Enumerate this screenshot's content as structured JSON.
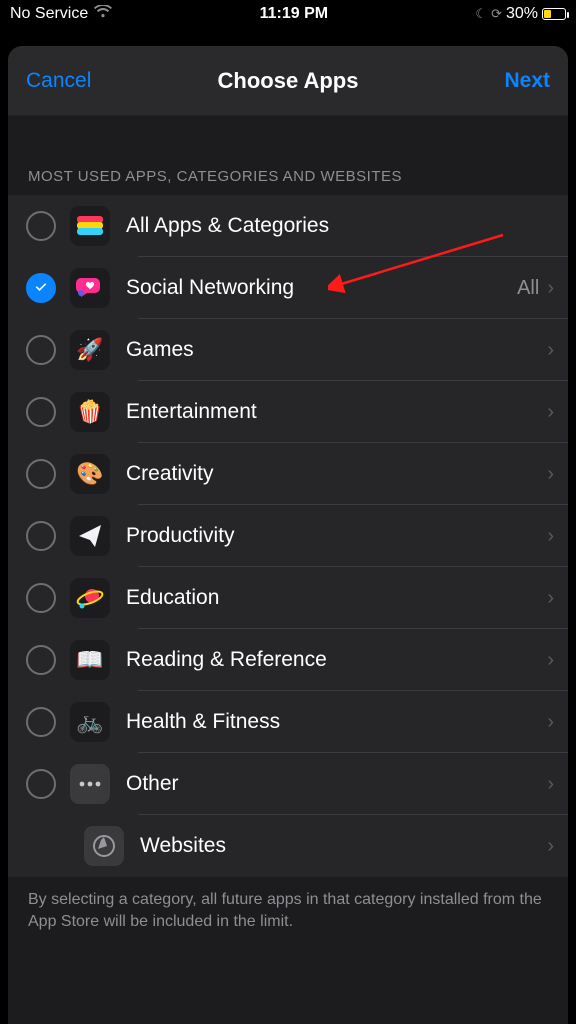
{
  "status": {
    "carrier": "No Service",
    "time": "11:19 PM",
    "battery_pct": "30%"
  },
  "nav": {
    "cancel": "Cancel",
    "title": "Choose Apps",
    "next": "Next"
  },
  "section_header": "MOST USED APPS, CATEGORIES AND WEBSITES",
  "rows": {
    "all": {
      "label": "All Apps & Categories"
    },
    "social": {
      "label": "Social Networking",
      "value": "All"
    },
    "games": {
      "label": "Games"
    },
    "ent": {
      "label": "Entertainment"
    },
    "create": {
      "label": "Creativity"
    },
    "prod": {
      "label": "Productivity"
    },
    "edu": {
      "label": "Education"
    },
    "read": {
      "label": "Reading & Reference"
    },
    "health": {
      "label": "Health & Fitness"
    },
    "other": {
      "label": "Other"
    },
    "web": {
      "label": "Websites"
    }
  },
  "footer": "By selecting a category, all future apps in that category installed from the App Store will be included in the limit."
}
